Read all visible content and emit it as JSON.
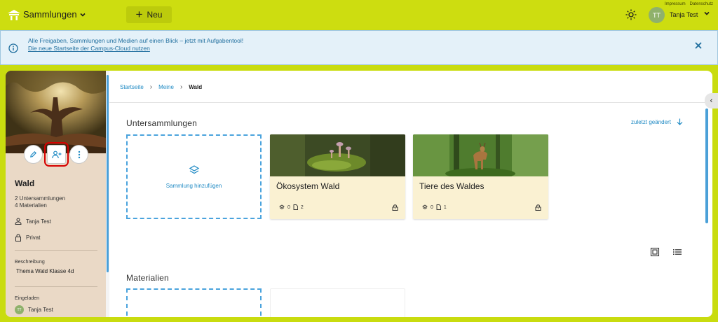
{
  "topbar": {
    "collections_menu": "Sammlungen",
    "new_button": "Neu",
    "legal_links": [
      "Impressum",
      "Datenschutz"
    ],
    "user_initials": "TT",
    "user_name": "Tanja Test"
  },
  "banner": {
    "text": "Alle Freigaben, Sammlungen und Medien auf einen Blick – jetzt mit Aufgabentool!",
    "link": "Die neue Startseite der Campus-Cloud nutzen"
  },
  "sidebar": {
    "title": "Wald",
    "subcollections": "2 Untersammlungen",
    "materials": "4 Materialien",
    "owner": "Tanja Test",
    "visibility": "Privat",
    "description_label": "Beschreibung",
    "description": "Thema Wald Klasse 4d",
    "invited_label": "Eingeladen",
    "invited_initials": "TT",
    "invited_user": "Tanja Test"
  },
  "breadcrumb": {
    "items": [
      "Startseite",
      "Meine"
    ],
    "current": "Wald"
  },
  "subcollections": {
    "title": "Untersammlungen",
    "sort_label": "zuletzt geändert",
    "add_label": "Sammlung hinzufügen",
    "cards": [
      {
        "title": "Ökosystem Wald",
        "collections": "0",
        "materials": "2"
      },
      {
        "title": "Tiere des Waldes",
        "collections": "0",
        "materials": "1"
      }
    ]
  },
  "materials_section": {
    "title": "Materialien"
  },
  "colors": {
    "topbar": "#cddd10",
    "accent": "#1f8ac4",
    "card_bg": "#faf1d2",
    "sidebar_bg": "#ead9c6",
    "highlight": "#d60000"
  }
}
